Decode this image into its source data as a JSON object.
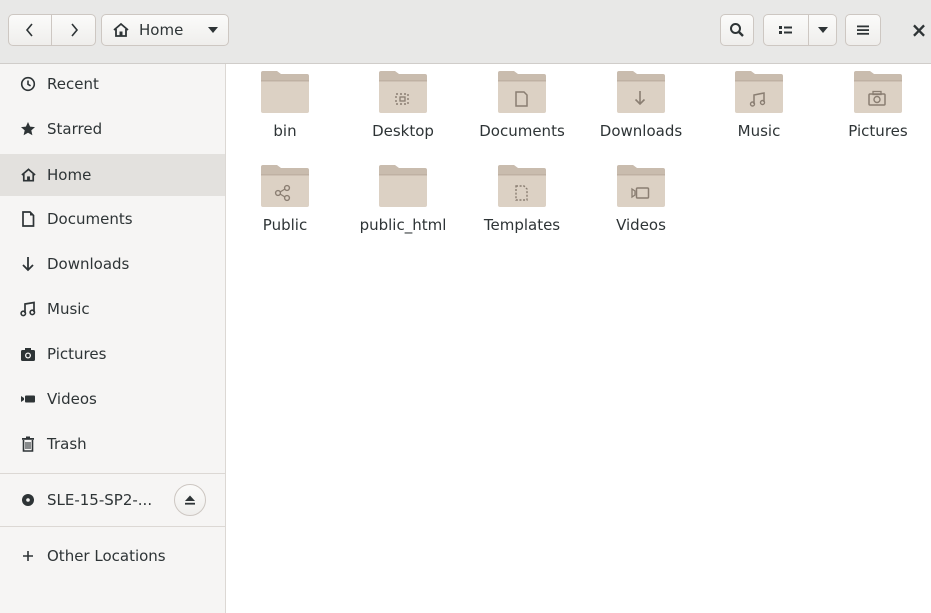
{
  "header": {
    "back_icon": "chevron-left-icon",
    "forward_icon": "chevron-right-icon",
    "path_label": "Home",
    "search_icon": "search-icon",
    "view_icon": "list-view-icon",
    "menu_icon": "hamburger-menu-icon",
    "close_label": "×"
  },
  "sidebar": {
    "items": [
      {
        "label": "Recent",
        "icon": "clock-icon"
      },
      {
        "label": "Starred",
        "icon": "star-icon"
      },
      {
        "label": "Home",
        "icon": "home-icon",
        "active": true
      },
      {
        "label": "Documents",
        "icon": "document-icon"
      },
      {
        "label": "Downloads",
        "icon": "download-arrow-icon"
      },
      {
        "label": "Music",
        "icon": "music-note-icon"
      },
      {
        "label": "Pictures",
        "icon": "camera-icon"
      },
      {
        "label": "Videos",
        "icon": "video-camera-icon"
      },
      {
        "label": "Trash",
        "icon": "trash-icon"
      }
    ],
    "device": {
      "label": "SLE-15-SP2-...",
      "icon": "disc-icon"
    },
    "other_locations": {
      "label": "Other Locations",
      "icon": "plus-icon"
    }
  },
  "content": {
    "folders": [
      {
        "name": "bin",
        "emblem": "none"
      },
      {
        "name": "Desktop",
        "emblem": "desktop"
      },
      {
        "name": "Documents",
        "emblem": "document"
      },
      {
        "name": "Downloads",
        "emblem": "download"
      },
      {
        "name": "Music",
        "emblem": "music"
      },
      {
        "name": "Pictures",
        "emblem": "camera"
      },
      {
        "name": "Public",
        "emblem": "share"
      },
      {
        "name": "public_html",
        "emblem": "none"
      },
      {
        "name": "Templates",
        "emblem": "template"
      },
      {
        "name": "Videos",
        "emblem": "video"
      }
    ]
  },
  "colors": {
    "header_bg": "#e8e8e7",
    "sidebar_bg": "#f6f5f4",
    "sidebar_active": "#e3e1de",
    "folder_fill": "#dcd1c4",
    "folder_tab": "#c9bcae",
    "folder_emblem": "#8a7e72"
  }
}
